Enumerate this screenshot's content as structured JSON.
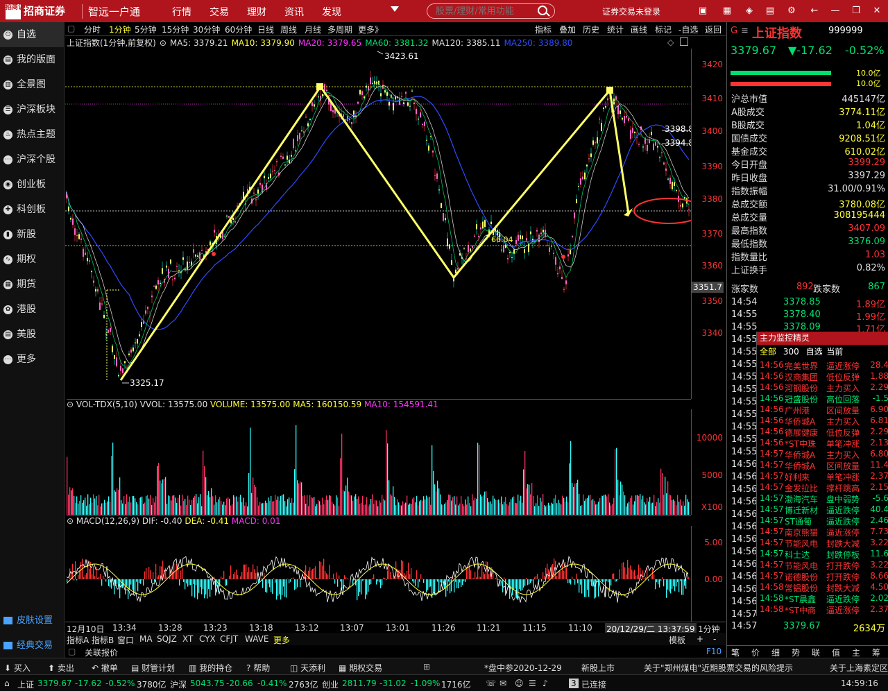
{
  "topbar": {
    "brand": "招商证券",
    "logo_mark": "招商证券",
    "app_name": "智远一户通",
    "menu": [
      "行情",
      "交易",
      "理财",
      "资讯",
      "发现"
    ],
    "search_placeholder": "股票/理财/常用功能",
    "login": "证券交易未登录"
  },
  "sidebar": {
    "items": [
      {
        "label": "自选",
        "icon": "power-icon"
      },
      {
        "label": "我的版面",
        "icon": "layout-icon"
      },
      {
        "label": "全景图",
        "icon": "panorama-icon"
      },
      {
        "label": "沪深板块",
        "icon": "sector-icon"
      },
      {
        "label": "热点主题",
        "icon": "fire-icon"
      },
      {
        "label": "沪深个股",
        "icon": "stocks-icon"
      },
      {
        "label": "创业板",
        "icon": "gem-icon"
      },
      {
        "label": "科创板",
        "icon": "star-board-icon"
      },
      {
        "label": "新股",
        "icon": "new-stock-icon"
      },
      {
        "label": "期权",
        "icon": "option-icon"
      },
      {
        "label": "期货",
        "icon": "futures-icon"
      },
      {
        "label": "港股",
        "icon": "hk-icon"
      },
      {
        "label": "美股",
        "icon": "us-icon"
      },
      {
        "label": "更多",
        "icon": "more-icon"
      }
    ],
    "bottom": [
      "皮肤设置",
      "经典交易"
    ]
  },
  "toolbar": {
    "periods": [
      "分时",
      "1分钟",
      "5分钟",
      "15分钟",
      "30分钟",
      "60分钟",
      "日线",
      "周线",
      "月线",
      "多周期",
      "更多"
    ],
    "more_arrow": "》",
    "active_period": "1分钟",
    "tools": [
      "指标",
      "叠加",
      "历史",
      "统计",
      "画线",
      "标记",
      "-自选",
      "返回"
    ]
  },
  "chart_info": {
    "title": "上证指数(1分钟,前复权)",
    "ma5": "MA5: 3379.21",
    "ma10": "MA10: 3379.90",
    "ma20": "MA20: 3379.65",
    "ma60": "MA60: 3381.32",
    "ma120": "MA120: 3385.11",
    "ma250": "MA250: 3389.80"
  },
  "annotations": {
    "high": "3423.61",
    "low": "3325.17",
    "mid": "66.04",
    "right_high": "3398.8",
    "right_mid": "3394.8",
    "current_price": "3351.7"
  },
  "price_axis": [
    "3420",
    "3410",
    "3400",
    "3390",
    "3380",
    "3370",
    "3360",
    "3350",
    "3340"
  ],
  "vol_info": {
    "name": "VOL-TDX(5,10)",
    "vvol": "VVOL: 13575.00",
    "volume": "VOLUME: 13575.00",
    "ma5": "MA5: 160150.59",
    "ma10": "MA10: 154591.41"
  },
  "vol_axis": [
    "10000",
    "5000",
    "X100"
  ],
  "macd_info": {
    "name": "MACD(12,26,9)",
    "dif": "DIF: -0.40",
    "dea": "DEA: -0.41",
    "macd": "MACD: 0.01"
  },
  "macd_axis": [
    "5.00",
    "0.00"
  ],
  "time_axis": {
    "labels": [
      "12月10日",
      "13:34",
      "13:28",
      "13:23",
      "13:18",
      "13:12",
      "13:07",
      "13:01",
      "11:26",
      "11:21",
      "11:15",
      "11:10"
    ],
    "cursor": "20/12/29/二 13:37:59",
    "period": "1分钟"
  },
  "bottom_tabs": [
    "指标A",
    "指标B",
    "窗口",
    "MA",
    "SQJZ",
    "XT",
    "CYX",
    "CFJT",
    "WAVE",
    "更多"
  ],
  "bottom_right": [
    "模板",
    "+",
    "-"
  ],
  "related": "关联报价",
  "related_key": "F10",
  "quote": {
    "name": "上证指数",
    "code": "999999",
    "marker": "G",
    "price": "3379.67",
    "change": "▼-17.62",
    "pct": "-0.52%",
    "bar_pct": [
      "10.0亿",
      "10.0亿"
    ],
    "rows": [
      {
        "label": "沪总市值",
        "value": "445147亿",
        "color": "white"
      },
      {
        "label": "A股成交",
        "value": "3774.11亿",
        "color": "yellow"
      },
      {
        "label": "B股成交",
        "value": "1.04亿",
        "color": "yellow"
      },
      {
        "label": "国债成交",
        "value": "9208.51亿",
        "color": "yellow"
      },
      {
        "label": "基金成交",
        "value": "610.02亿",
        "color": "yellow"
      },
      {
        "label": "今日开盘",
        "value": "3399.29",
        "color": "red"
      },
      {
        "label": "昨日收盘",
        "value": "3397.29",
        "color": "white"
      },
      {
        "label": "指数振幅",
        "value": "31.00/0.91%",
        "color": "white"
      },
      {
        "label": "总成交额",
        "value": "3780.08亿",
        "color": "yellow"
      },
      {
        "label": "总成交量",
        "value": "308195444",
        "color": "yellow"
      },
      {
        "label": "最高指数",
        "value": "3407.09",
        "color": "red"
      },
      {
        "label": "最低指数",
        "value": "3376.09",
        "color": "green"
      },
      {
        "label": "指数量比",
        "value": "1.03",
        "color": "red"
      },
      {
        "label": "上证换手",
        "value": "0.82%",
        "color": "white"
      }
    ],
    "rise_label": "涨家数",
    "rise": "892",
    "fall_label": "跌家数",
    "fall": "867"
  },
  "ticks": [
    {
      "t": "14:54",
      "p": "3378.85",
      "v": "1.89亿"
    },
    {
      "t": "14:55",
      "p": "3378.40",
      "v": "1.99亿"
    },
    {
      "t": "14:55",
      "p": "3378.09",
      "v": "1.71亿"
    }
  ],
  "tick_times": [
    "14:55",
    "14:55",
    "14:55",
    "14:55",
    "14:55",
    "14:55",
    "14:55",
    "14:55",
    "14:55",
    "14:55",
    "14:56",
    "14:56",
    "14:56",
    "14:56",
    "14:56",
    "14:56",
    "14:56",
    "14:56",
    "14:56",
    "14:56",
    "14:56",
    "14:56",
    "14:57"
  ],
  "last_tick": {
    "t": "14:57",
    "p": "3379.67",
    "v": "2634万"
  },
  "monitor": {
    "title": "主力监控精灵",
    "filter": [
      "全部",
      "300",
      "自选",
      "当前"
    ],
    "rows": [
      {
        "t": "14:56",
        "n": "完美世界",
        "e": "逼近涨停",
        "v": "28.4",
        "c": "red"
      },
      {
        "t": "14:56",
        "n": "汉商集团",
        "e": "低位反弹",
        "v": "1.88",
        "c": "red"
      },
      {
        "t": "14:56",
        "n": "河钢股份",
        "e": "主力买入",
        "v": "2.29",
        "c": "red"
      },
      {
        "t": "14:56",
        "n": "冠盛股份",
        "e": "高位回落",
        "v": "-1.5",
        "c": "green"
      },
      {
        "t": "14:56",
        "n": "广州港",
        "e": "区间放量",
        "v": "6.90",
        "c": "red"
      },
      {
        "t": "14:56",
        "n": "华侨城A",
        "e": "主力买入",
        "v": "6.81",
        "c": "red"
      },
      {
        "t": "14:56",
        "n": "德展健康",
        "e": "低位反弹",
        "v": "2.29",
        "c": "red"
      },
      {
        "t": "14:56",
        "n": "*ST中珠",
        "e": "单笔冲涨",
        "v": "2.13",
        "c": "red"
      },
      {
        "t": "14:57",
        "n": "华侨城A",
        "e": "主力买入",
        "v": "6.80",
        "c": "red"
      },
      {
        "t": "14:57",
        "n": "华侨城A",
        "e": "区间放量",
        "v": "11.4",
        "c": "red"
      },
      {
        "t": "14:57",
        "n": "好利来",
        "e": "单笔冲涨",
        "v": "2.37",
        "c": "red"
      },
      {
        "t": "14:57",
        "n": "金发拉比",
        "e": "撑杆跳高",
        "v": "2.15",
        "c": "red"
      },
      {
        "t": "14:57",
        "n": "渤海汽车",
        "e": "盘中弱势",
        "v": "-5.6",
        "c": "green"
      },
      {
        "t": "14:57",
        "n": "博迁新材",
        "e": "逼近跌停",
        "v": "40.4",
        "c": "green"
      },
      {
        "t": "14:57",
        "n": "ST通葡",
        "e": "逼近跌停",
        "v": "2.46",
        "c": "green"
      },
      {
        "t": "14:57",
        "n": "南京熊猫",
        "e": "逼近涨停",
        "v": "7.73",
        "c": "red"
      },
      {
        "t": "14:57",
        "n": "节能风电",
        "e": "封跌大减",
        "v": "3.22",
        "c": "red"
      },
      {
        "t": "14:57",
        "n": "科士达",
        "e": "封跌停板",
        "v": "11.6",
        "c": "green"
      },
      {
        "t": "14:57",
        "n": "节能风电",
        "e": "打开跌停",
        "v": "3.22",
        "c": "red"
      },
      {
        "t": "14:57",
        "n": "诺德股份",
        "e": "打开跌停",
        "v": "8.66",
        "c": "red"
      },
      {
        "t": "14:58",
        "n": "常铝股份",
        "e": "封跌大减",
        "v": "4.50",
        "c": "red"
      },
      {
        "t": "14:58",
        "n": "*ST晨鑫",
        "e": "逼近跌停",
        "v": "2.02",
        "c": "green"
      },
      {
        "t": "14:58",
        "n": "*ST中商",
        "e": "逼近涨停",
        "v": "2.37",
        "c": "red"
      }
    ]
  },
  "right_tabs": [
    "笔",
    "价",
    "细",
    "势",
    "联",
    "值",
    "主",
    "筹"
  ],
  "actions": [
    "买入",
    "卖出",
    "撤单",
    "财管计划",
    "我的持仓",
    "帮助",
    "天添利",
    "期权交易"
  ],
  "ticker_news": [
    "*盘中参2020-12-29",
    "新股上市",
    "关于\"郑州煤电\"近期股票交易的风险提示",
    "关于上海素定区"
  ],
  "status": {
    "sh_label": "上证",
    "sh_price": "3379.67",
    "sh_chg": "-17.62",
    "sh_pct": "-0.52%",
    "sh_amt": "3780亿",
    "sz_label": "沪深",
    "sz_price": "5043.75",
    "sz_chg": "-20.66",
    "sz_pct": "-0.41%",
    "sz_amt": "2763亿",
    "cy_label": "创业",
    "cy_price": "2811.79",
    "cy_chg": "-31.02",
    "cy_pct": "-1.09%",
    "cy_amt": "1716亿",
    "conn_count": "3",
    "conn": "已连接",
    "time": "14:59:16"
  },
  "colors": {
    "bg": "#000000",
    "titlebar": "#b0141c",
    "up": "#ff3333",
    "down": "#00e070",
    "ma5": "#ffffff",
    "ma10": "#ffff33",
    "ma20": "#ff33ff",
    "ma60": "#00ff00",
    "ma120": "#ffffff",
    "ma250": "#2e4bff",
    "vol_up": "#ff3333",
    "vol_down": "#33ffff",
    "zigzag": "#ffff66"
  }
}
